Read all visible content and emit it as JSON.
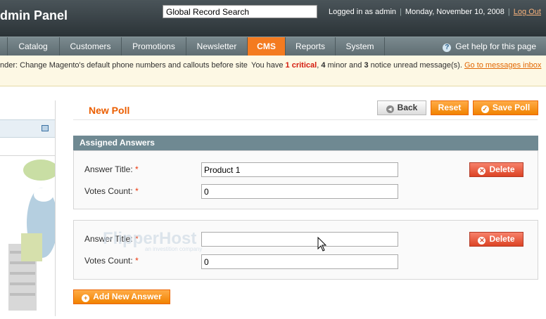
{
  "header": {
    "brand": "dmin Panel",
    "search_value": "Global Record Search",
    "logged_in": "Logged in as admin",
    "date": "Monday, November 10, 2008",
    "logout": "Log Out"
  },
  "nav": {
    "items": [
      {
        "label": "Catalog"
      },
      {
        "label": "Customers"
      },
      {
        "label": "Promotions"
      },
      {
        "label": "Newsletter"
      },
      {
        "label": "CMS"
      },
      {
        "label": "Reports"
      },
      {
        "label": "System"
      }
    ],
    "help": "Get help for this page"
  },
  "notice": {
    "left": "nder: Change Magento's default phone numbers and callouts before site",
    "prefix": "You have",
    "critical": "1 critical",
    "minor_count": "4",
    "minor_text": "minor and",
    "notice_count": "3",
    "notice_text": "notice unread message(s).",
    "link": "Go to messages inbox"
  },
  "page": {
    "title": "New Poll",
    "back": "Back",
    "reset": "Reset",
    "save": "Save Poll"
  },
  "section": {
    "title": "Assigned Answers"
  },
  "answers": [
    {
      "title_label": "Answer Title:",
      "title_value": "Product 1",
      "votes_label": "Votes Count:",
      "votes_value": "0",
      "delete": "Delete"
    },
    {
      "title_label": "Answer Title:",
      "title_value": "",
      "votes_label": "Votes Count:",
      "votes_value": "0",
      "delete": "Delete"
    }
  ],
  "add_answer": "Add New Answer",
  "watermark": {
    "text": "FlipperHost",
    "sub": "an investition company"
  },
  "colors": {
    "accent": "#f47b20",
    "header": "#2b3337",
    "section": "#6f8992",
    "delete": "#dc4324"
  }
}
